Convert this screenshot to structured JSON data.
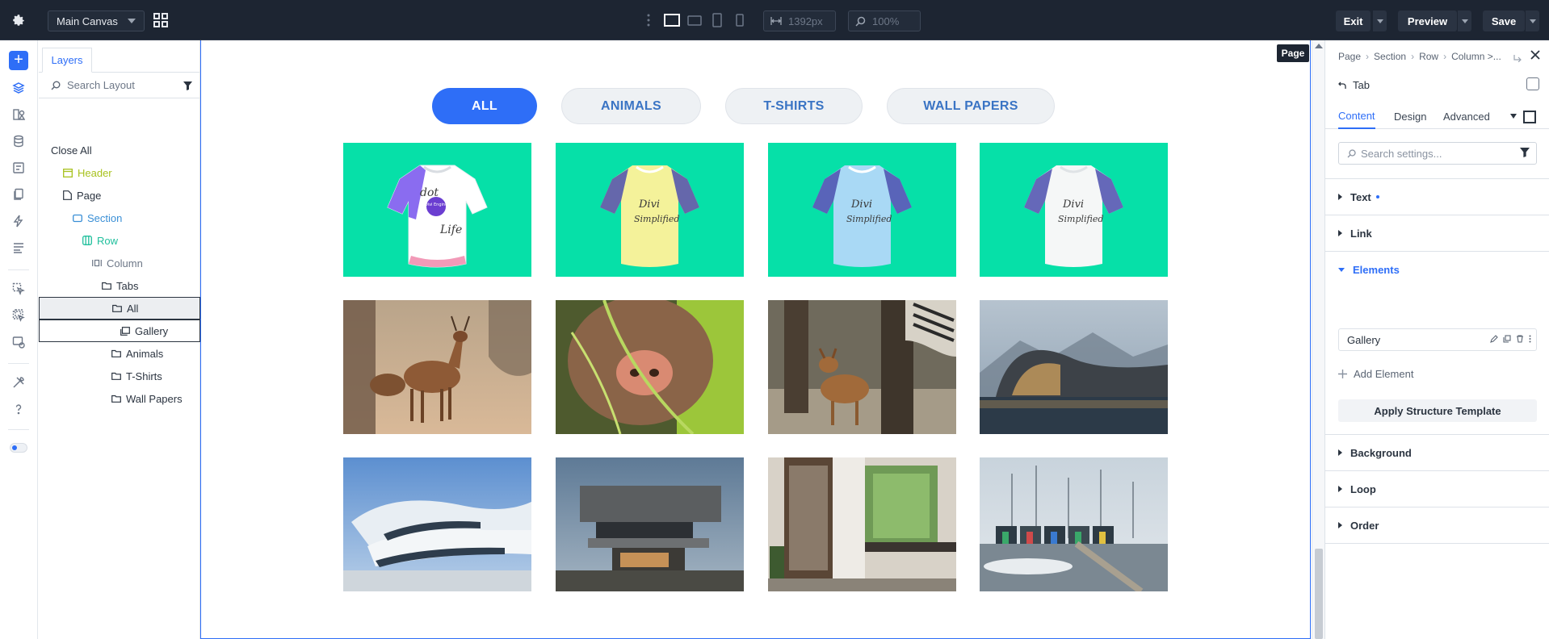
{
  "topbar": {
    "canvas_select": "Main Canvas",
    "width_value": "1392px",
    "zoom_value": "100%",
    "exit_label": "Exit",
    "preview_label": "Preview",
    "save_label": "Save"
  },
  "layers": {
    "tab_label": "Layers",
    "search_placeholder": "Search Layout",
    "close_all": "Close All",
    "tree": [
      {
        "label": "Header",
        "icon": "header-icon"
      },
      {
        "label": "Page",
        "icon": "page-icon"
      },
      {
        "label": "Section",
        "icon": "section-icon"
      },
      {
        "label": "Row",
        "icon": "row-icon"
      },
      {
        "label": "Column",
        "icon": "column-icon"
      },
      {
        "label": "Tabs",
        "icon": "folder-icon"
      },
      {
        "label": "All",
        "icon": "folder-icon"
      },
      {
        "label": "Gallery",
        "icon": "gallery-icon"
      },
      {
        "label": "Animals",
        "icon": "folder-icon"
      },
      {
        "label": "T-Shirts",
        "icon": "folder-icon"
      },
      {
        "label": "Wall Papers",
        "icon": "folder-icon"
      }
    ]
  },
  "canvas": {
    "page_badge": "Page",
    "filters": [
      "ALL",
      "ANIMALS",
      "T-SHIRTS",
      "WALL PAPERS"
    ],
    "active_filter": "ALL",
    "tshirt_tiles": [
      {
        "text1": "dot",
        "text2": "Life",
        "badge": "Divi Engine",
        "shirt": "#ffffff",
        "sleeve": "#8a6cf0"
      },
      {
        "text1": "Divi",
        "text2": "Simplified",
        "shirt": "#f4f29a",
        "sleeve": "#4b4fae"
      },
      {
        "text1": "Divi",
        "text2": "Simplified",
        "shirt": "#a9d9f5",
        "sleeve": "#4b4fae"
      },
      {
        "text1": "Divi",
        "text2": "Simplified",
        "shirt": "#f5f7f7",
        "sleeve": "#4b4fae"
      }
    ]
  },
  "settings": {
    "breadcrumb": [
      "Page",
      "Section",
      "Row",
      "Column >..."
    ],
    "module_title": "Tab",
    "tabs": [
      "Content",
      "Design",
      "Advanced"
    ],
    "active_tab": "Content",
    "search_placeholder": "Search settings...",
    "groups": {
      "text": "Text",
      "link": "Link",
      "elements": "Elements",
      "background": "Background",
      "loop": "Loop",
      "order": "Order"
    },
    "element_item": "Gallery",
    "add_element": "Add Element",
    "apply_template": "Apply Structure Template"
  },
  "colors": {
    "accent": "#2e6ef7",
    "topbar": "#1d2532",
    "tile_green": "#06e0a8"
  }
}
